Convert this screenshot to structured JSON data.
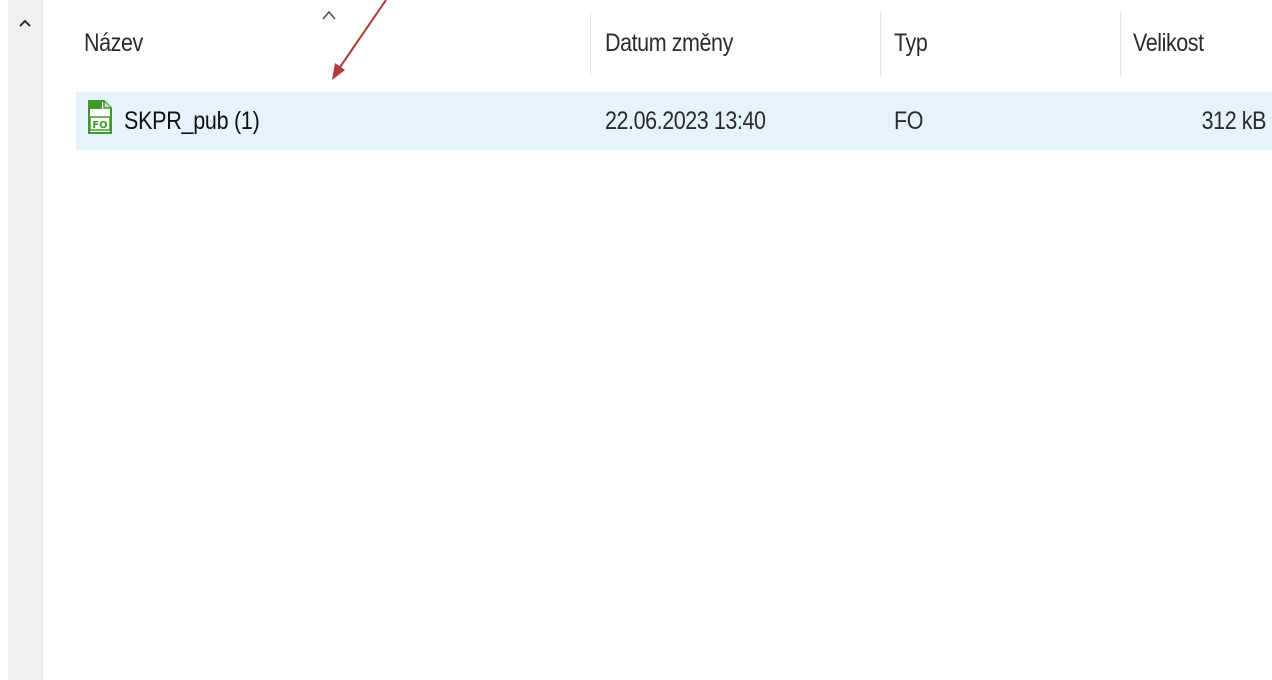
{
  "nav": {
    "scroll_up_icon": "chevron-up-icon"
  },
  "columns": {
    "name": "Název",
    "date": "Datum změny",
    "type": "Typ",
    "size": "Velikost",
    "sort_icon": "sort-ascending-icon"
  },
  "rows": [
    {
      "name": "SKPR_pub (1)",
      "date": "22.06.2023 13:40",
      "type": "FO",
      "size": "312 kB",
      "icon": "fo-file-icon",
      "icon_text": "FO",
      "selected": true
    }
  ],
  "colors": {
    "selection": "#e5f3ff",
    "annotation_arrow": "#b03a3a",
    "file_icon": "#3f9a2b"
  },
  "annotation": {
    "icon": "arrow-annotation-icon"
  }
}
